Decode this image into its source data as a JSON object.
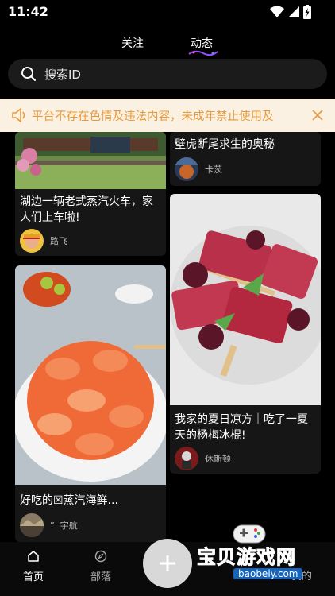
{
  "status_bar": {
    "time": "11:42"
  },
  "top_tabs": {
    "follow": "关注",
    "feed": "动态"
  },
  "search": {
    "placeholder": "搜索ID"
  },
  "notice": {
    "text": "平台不存在色情及违法内容，未成年禁止使用及"
  },
  "posts": [
    {
      "title": "湖边一辆老式蒸汽火车，家人们上车啦!",
      "author": "路飞"
    },
    {
      "title": "壁虎断尾求生的奥秘",
      "author": "卡茨"
    },
    {
      "title": "我家的夏日凉方｜吃了一夏天的杨梅冰棍!",
      "author": "休斯顿"
    },
    {
      "title": "好吃的☒蒸汽海鲜...",
      "author": "宇航"
    }
  ],
  "posts_extra": {
    "author_prefix_4": "”"
  },
  "bottom_nav": {
    "home": "首页",
    "tribe": "部落",
    "mine": "我的"
  },
  "watermark": {
    "name": "宝贝游戏网",
    "url": "baobeiy.com"
  },
  "colors": {
    "notice_bg": "#fbf1e2",
    "notice_text": "#e69a3f",
    "watermark": "#f6b21d"
  }
}
